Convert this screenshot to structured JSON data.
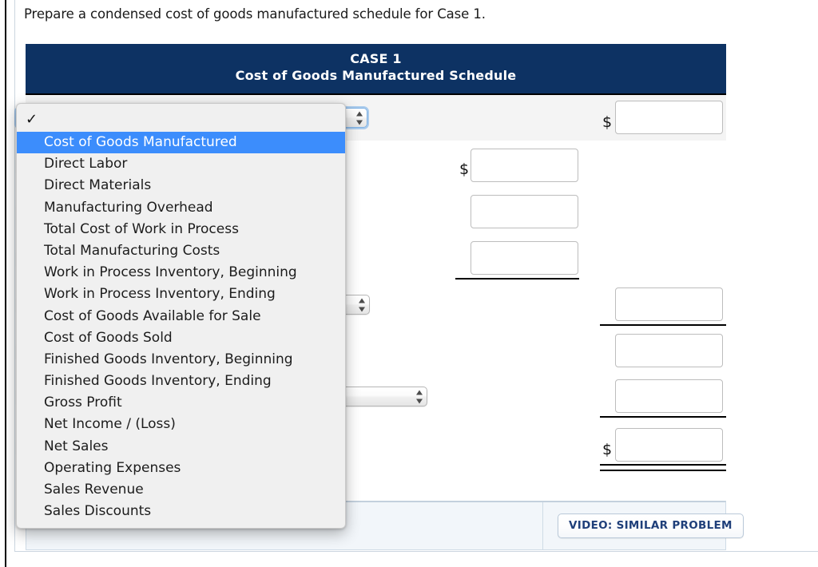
{
  "prompt": "Prepare a condensed cost of goods manufactured schedule for Case 1.",
  "schedule": {
    "header": {
      "case_label": "CASE 1",
      "title": "Cost of Goods Manufactured Schedule"
    },
    "currency_symbol": "$",
    "rows": [
      {
        "name": "row-1",
        "select_value": "",
        "amount_value": ""
      },
      {
        "name": "row-2",
        "select_value": "",
        "amount_value": ""
      },
      {
        "name": "row-3",
        "select_value": "",
        "amount_value": ""
      },
      {
        "name": "row-4",
        "select_value": "",
        "amount_value": ""
      },
      {
        "name": "row-5",
        "select_value": "",
        "amount_value": ""
      },
      {
        "name": "row-6",
        "select_value": "",
        "amount_value": ""
      },
      {
        "name": "row-7",
        "select_value": "",
        "amount_value": ""
      },
      {
        "name": "row-8",
        "select_value": "",
        "amount_value": ""
      }
    ]
  },
  "dropdown": {
    "checkmark_glyph": "✓",
    "blank_option_label": "",
    "selected_option": "Cost of Goods Manufactured",
    "options": [
      "Cost of Goods Manufactured",
      "Direct Labor",
      "Direct Materials",
      "Manufacturing Overhead",
      "Total Cost of Work in Process",
      "Total Manufacturing Costs",
      "Work in Process Inventory, Beginning",
      "Work in Process Inventory, Ending",
      "Cost of Goods Available for Sale",
      "Cost of Goods Sold",
      "Finished Goods Inventory, Beginning",
      "Finished Goods Inventory, Ending",
      "Gross Profit",
      "Net Income / (Loss)",
      "Net Sales",
      "Operating Expenses",
      "Sales Revenue",
      "Sales Discounts"
    ]
  },
  "footer": {
    "video_button_label": "VIDEO: SIMILAR PROBLEM"
  },
  "colors": {
    "header_navy": "#0d3263",
    "highlight_blue": "#3c8dfc",
    "video_text": "#1f3f7a",
    "alt_row": "#f4f4f4"
  }
}
